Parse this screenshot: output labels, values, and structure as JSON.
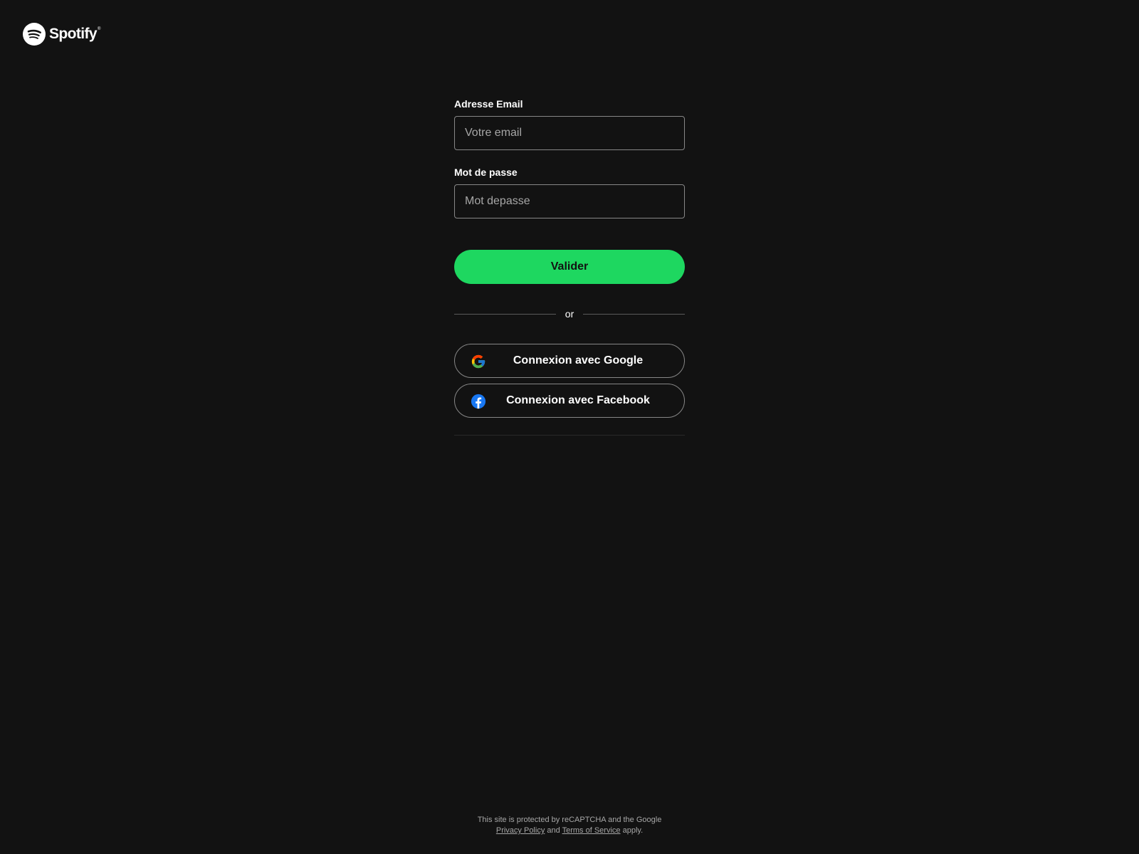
{
  "brand": {
    "name": "Spotify",
    "trademark": "®",
    "logo_icon": "spotify-logo-icon",
    "color": "#ffffff"
  },
  "form": {
    "email": {
      "label": "Adresse Email",
      "placeholder": "Votre email",
      "value": ""
    },
    "password": {
      "label": "Mot de passe",
      "placeholder": "Mot depasse",
      "value": ""
    },
    "submit_label": "Valider",
    "divider_text": "or",
    "social": [
      {
        "label": "Connexion avec Google",
        "icon": "google-icon"
      },
      {
        "label": "Connexion avec Facebook",
        "icon": "facebook-icon"
      }
    ]
  },
  "footer": {
    "line1": "This site is protected by reCAPTCHA and the Google",
    "privacy_link": "Privacy Policy",
    "and_text": "and",
    "terms_link": "Terms of Service",
    "apply_text": "apply."
  },
  "colors": {
    "background": "#121212",
    "accent": "#1ed760",
    "input_border": "#878787",
    "facebook_blue": "#1877f2"
  }
}
